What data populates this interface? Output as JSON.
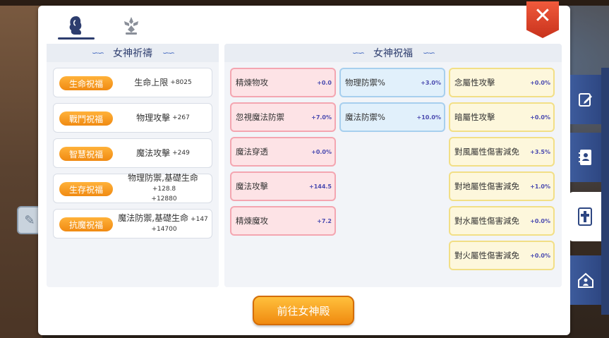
{
  "tabs": [
    {
      "name": "goddess-silhouette-icon",
      "active": true
    },
    {
      "name": "blossom-emblem-icon",
      "active": false
    }
  ],
  "close_label": "✕",
  "left_panel": {
    "title": "女神祈禱",
    "rows": [
      {
        "pill": "生命祝福",
        "text": "生命上限",
        "bonus": "+8025"
      },
      {
        "pill": "戰鬥祝福",
        "text": "物理攻擊",
        "bonus": "+267"
      },
      {
        "pill": "智慧祝福",
        "text": "魔法攻擊",
        "bonus": "+249"
      },
      {
        "pill": "生存祝福",
        "text": "物理防禦,基礎生命",
        "bonus": "+128.8",
        "bonus2": "+12880"
      },
      {
        "pill": "抗魔祝福",
        "text": "魔法防禦,基礎生命",
        "bonus": "+147",
        "bonus2": "+14700"
      }
    ]
  },
  "right_panel": {
    "title": "女神祝福",
    "col1": [
      {
        "label": "精煉物攻",
        "value": "+0.0"
      },
      {
        "label": "忽視魔法防禦",
        "value": "+7.0%"
      },
      {
        "label": "魔法穿透",
        "value": "+0.0%"
      },
      {
        "label": "魔法攻擊",
        "value": "+144.5"
      },
      {
        "label": "精煉魔攻",
        "value": "+7.2"
      }
    ],
    "col2": [
      {
        "label": "物理防禦%",
        "value": "+3.0%"
      },
      {
        "label": "魔法防禦%",
        "value": "+10.0%"
      }
    ],
    "col3": [
      {
        "label": "念屬性攻擊",
        "value": "+0.0%"
      },
      {
        "label": "暗屬性攻擊",
        "value": "+0.0%"
      },
      {
        "label": "對風屬性傷害減免",
        "value": "+3.5%"
      },
      {
        "label": "對地屬性傷害減免",
        "value": "+1.0%"
      },
      {
        "label": "對水屬性傷害減免",
        "value": "+0.0%"
      },
      {
        "label": "對火屬性傷害減免",
        "value": "+0.0%"
      }
    ]
  },
  "go_button": "前往女神殿",
  "side_tabs": [
    {
      "name": "edit-note-icon"
    },
    {
      "name": "contacts-book-icon"
    },
    {
      "name": "holy-cross-icon",
      "active": true
    },
    {
      "name": "home-user-icon"
    }
  ],
  "colors": {
    "accent": "#f08a12",
    "navy": "#2d3d6e",
    "close": "#e0452a"
  }
}
